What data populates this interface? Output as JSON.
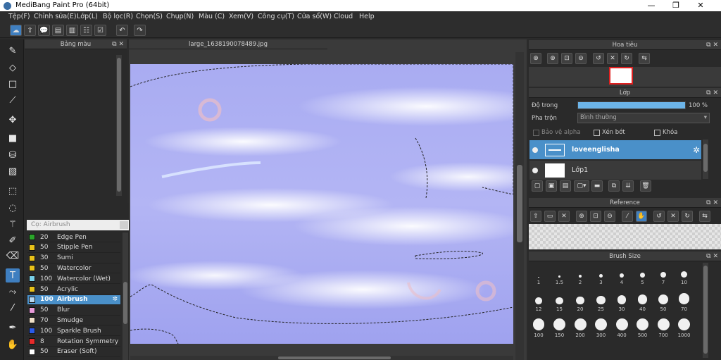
{
  "titlebar": {
    "title": "MediBang Paint Pro (64bit)",
    "minimize": "—",
    "maximize": "❐",
    "close": "✕"
  },
  "menu": [
    "Tệp(F)",
    "Chỉnh sửa(E)",
    "Lớp(L)",
    "Bộ lọc(R)",
    "Chọn(S)",
    "Chụp(N)",
    "Màu (C)",
    "Xem(V)",
    "Công cụ(T)",
    "Cửa sổ(W)",
    "Cloud",
    "Help"
  ],
  "color_panel": {
    "title": "Bảng màu",
    "footer_text": "---"
  },
  "brush_panel": {
    "title": "Cọ: Airbrush",
    "items": [
      {
        "size": "20",
        "name": "Edge Pen",
        "color": "#2aa52a"
      },
      {
        "size": "50",
        "name": "Stipple Pen",
        "color": "#e8c21a"
      },
      {
        "size": "30",
        "name": "Sumi",
        "color": "#e8c21a"
      },
      {
        "size": "50",
        "name": "Watercolor",
        "color": "#e8c21a"
      },
      {
        "size": "100",
        "name": "Watercolor (Wet)",
        "color": "#78d0e8"
      },
      {
        "size": "50",
        "name": "Acrylic",
        "color": "#e8c21a"
      },
      {
        "size": "100",
        "name": "Airbrush",
        "color": "#b8d8f0",
        "selected": true
      },
      {
        "size": "50",
        "name": "Blur",
        "color": "#e89ad8"
      },
      {
        "size": "70",
        "name": "Smudge",
        "color": "#f0e0c8"
      },
      {
        "size": "100",
        "name": "Sparkle Brush",
        "color": "#2a5ae8"
      },
      {
        "size": "8",
        "name": "Rotation Symmetry Pe",
        "color": "#e82a2a"
      },
      {
        "size": "50",
        "name": "Eraser (Soft)",
        "color": "#ffffff"
      }
    ]
  },
  "document": {
    "tab": "large_1638190078489.jpg"
  },
  "navigator": {
    "title": "Hoa tiêu"
  },
  "layer_panel": {
    "title": "Lớp",
    "opacity_label": "Độ trong",
    "opacity_value": "100 %",
    "opacity": 1.0,
    "blend_label": "Pha trộn",
    "blend_value": "Bình thường",
    "protect_alpha": "Bảo vệ alpha",
    "clipping": "Xén bớt",
    "lock": "Khóa",
    "layers": [
      {
        "name": "loveenglisha",
        "selected": true
      },
      {
        "name": "Lớp1",
        "selected": false
      }
    ]
  },
  "reference": {
    "title": "Reference"
  },
  "brush_size": {
    "title": "Brush Size",
    "rows": [
      [
        "1",
        "1.5",
        "2",
        "3",
        "4",
        "5",
        "7",
        "10"
      ],
      [
        "12",
        "15",
        "20",
        "25",
        "30",
        "40",
        "50",
        "70"
      ],
      [
        "100",
        "150",
        "200",
        "300",
        "400",
        "500",
        "700",
        "1000"
      ]
    ]
  }
}
